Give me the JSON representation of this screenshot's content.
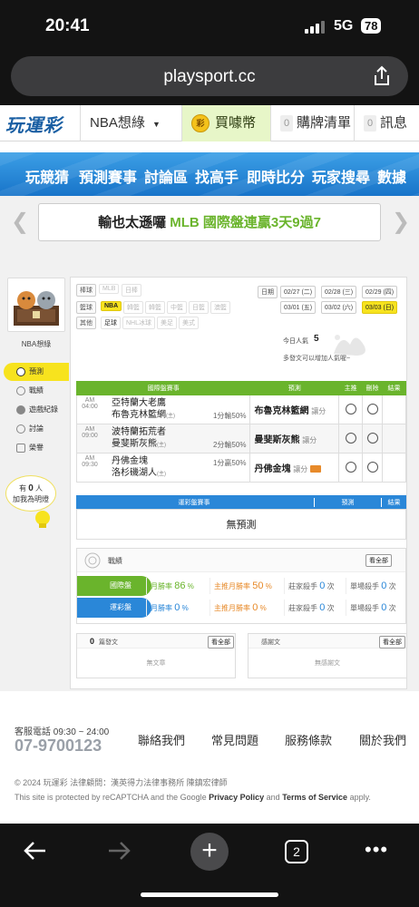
{
  "status": {
    "time": "20:41",
    "network": "5G",
    "battery": "78"
  },
  "browser": {
    "url": "playsport.cc",
    "tab_count": "2"
  },
  "topnav": {
    "logo": "玩運彩",
    "sport_select": "NBA想綠",
    "buy_label": "買噱幣",
    "coin_glyph": "彩",
    "orders_count": "0",
    "orders_label": "購牌清單",
    "messages_count": "0",
    "messages_label": "訊息"
  },
  "menu": [
    "玩競猜",
    "預測賽事",
    "討論區",
    "找高手",
    "即時比分",
    "玩家搜尋",
    "數據"
  ],
  "announcement": {
    "text": "輸也太遜囉 MLB 國際盤連贏3天9過7"
  },
  "sidebar": {
    "username": "NBA想綠",
    "items": [
      "預測",
      "戰績",
      "遊戲紀錄",
      "討論",
      "榮譽"
    ],
    "fans_prefix": "有",
    "fans_count": "0",
    "fans_suffix": "人",
    "fans_line2": "加我為明燈"
  },
  "filters": {
    "row1_label": "棒球",
    "row1_options": [
      "MLB",
      "日棒"
    ],
    "row2_label": "籃球",
    "row2_options": [
      "NBA",
      "韓籃",
      "韓籃",
      "中籃",
      "日籃",
      "澳籃"
    ],
    "row3_label": "其他",
    "row3_options": [
      "足球",
      "NHL冰球",
      "美足",
      "美式"
    ],
    "date_label": "日期",
    "dates": [
      "02/27 (二)",
      "02/28 (三)",
      "02/29 (四)",
      "03/01 (五)",
      "03/02 (六)",
      "03/03 (日)"
    ],
    "selected_date": "03/03 (日)"
  },
  "popularity": {
    "label": "今日人氣",
    "value": "5",
    "hint": "多發文可以增加人氣喔~"
  },
  "international_table": {
    "headers": [
      "國際盤賽事",
      "預測",
      "主推",
      "刪除",
      "結果"
    ],
    "rows": [
      {
        "ampm": "AM",
        "time": "04:00",
        "team1": "亞特蘭大老鷹",
        "team2": "布魯克林籃網",
        "tag": "(主)",
        "odds": "1分輸50%",
        "pick": "布魯克林籃網",
        "pick_type": "讓分",
        "hot": false
      },
      {
        "ampm": "AM",
        "time": "09:00",
        "team1": "波特蘭拓荒者",
        "team2": "曼斐斯灰熊",
        "tag": "(主)",
        "odds": "2分輸50%",
        "pick": "曼斐斯灰熊",
        "pick_type": "讓分",
        "hot": false
      },
      {
        "ampm": "AM",
        "time": "09:30",
        "team1": "丹佛金塊",
        "team2": "洛杉磯湖人",
        "tag": "(主)",
        "odds": "1分贏50%",
        "pick": "丹佛金塊",
        "pick_type": "讓分",
        "hot": true
      }
    ]
  },
  "lottery_table": {
    "headers": [
      "運彩盤賽事",
      "預測",
      "結果"
    ],
    "empty": "無預測"
  },
  "record": {
    "title": "戰績",
    "view_all": "看全部",
    "intl": {
      "label": "國際盤",
      "month_label": "月勝率",
      "month": "86",
      "main_label": "主推月勝率",
      "main": "50",
      "banker_label": "莊家殺手",
      "banker": "0",
      "single_label": "單場殺手",
      "single": "0",
      "unit": "%",
      "unit2": "次"
    },
    "lottery": {
      "label": "運彩盤",
      "month_label": "月勝率",
      "month": "0",
      "main_label": "主推月勝率",
      "main": "0",
      "banker_label": "莊家殺手",
      "banker": "0",
      "single_label": "單場殺手",
      "single": "0",
      "unit": "%",
      "unit2": "次"
    }
  },
  "posts": {
    "count": "0",
    "label": "篇發文",
    "view_all": "看全部",
    "empty": "無文章"
  },
  "replies": {
    "label": "感謝文",
    "view_all": "看全部",
    "empty": "無感謝文"
  },
  "footer": {
    "hotline_label": "客服電話 09:30 ~ 24:00",
    "hotline": "07-9700123",
    "links": [
      "聯絡我們",
      "常見問題",
      "服務條款",
      "關於我們"
    ],
    "copyright": "© 2024 玩運彩 法律顧問：漢英得力法律事務所 陳鎮宏律師",
    "recaptcha_pre": "This site is protected by reCAPTCHA and the Google ",
    "privacy": "Privacy Policy",
    "and": " and ",
    "terms": "Terms of Service",
    "apply": " apply."
  },
  "colors": {
    "green": "#6ab42c",
    "blue": "#2a87d8",
    "yellow": "#f7e31e",
    "menu_blue": "#1f7fd1"
  }
}
